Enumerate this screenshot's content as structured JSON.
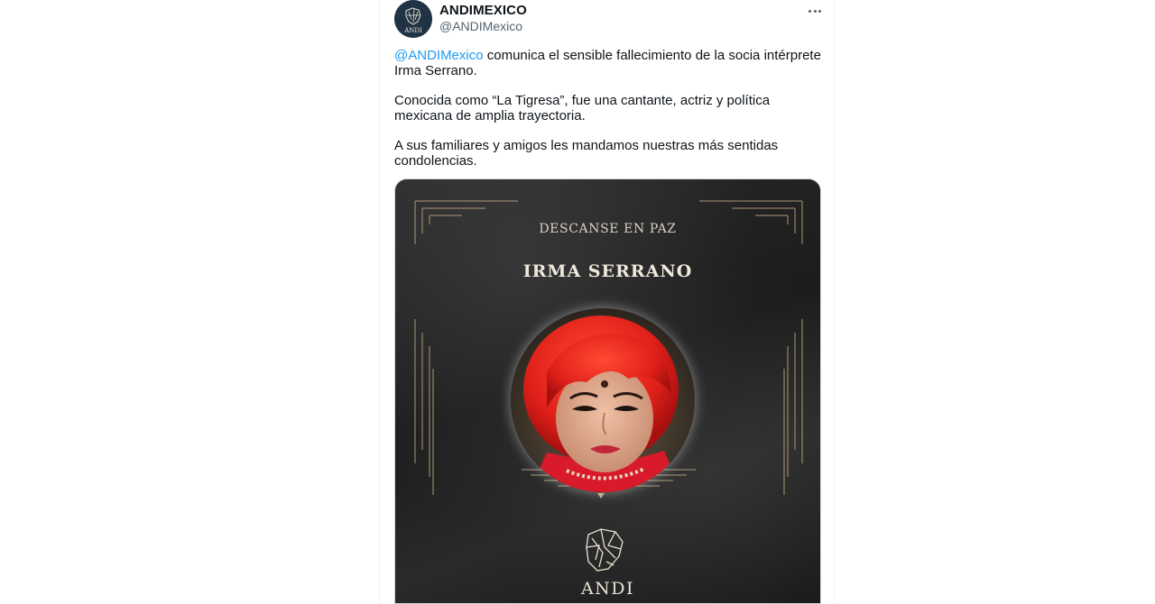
{
  "author": {
    "name": "ANDIMEXICO",
    "handle": "@ANDIMexico",
    "avatar_text": "ANDI"
  },
  "tweet": {
    "paragraphs": [
      {
        "mention": "@ANDIMexico",
        "text": " comunica el sensible fallecimiento de la socia intérprete Irma Serrano."
      },
      {
        "text": "Conocida como “La Tigresa”, fue una cantante, actriz y política mexicana de amplia trayectoria."
      },
      {
        "text": "A sus familiares y amigos les mandamos nuestras más sentidas condolencias."
      }
    ]
  },
  "media": {
    "caption": "DESCANSE EN PAZ",
    "name": "IRMA SERRANO",
    "brand": "ANDI"
  },
  "icons": {
    "more": "more-options-icon",
    "logo": "andi-logo-icon"
  },
  "colors": {
    "link": "#1d9bf0",
    "text": "#0f1419",
    "secondary": "#536471",
    "card_background": "#242424",
    "gold": "#b8a57f"
  }
}
